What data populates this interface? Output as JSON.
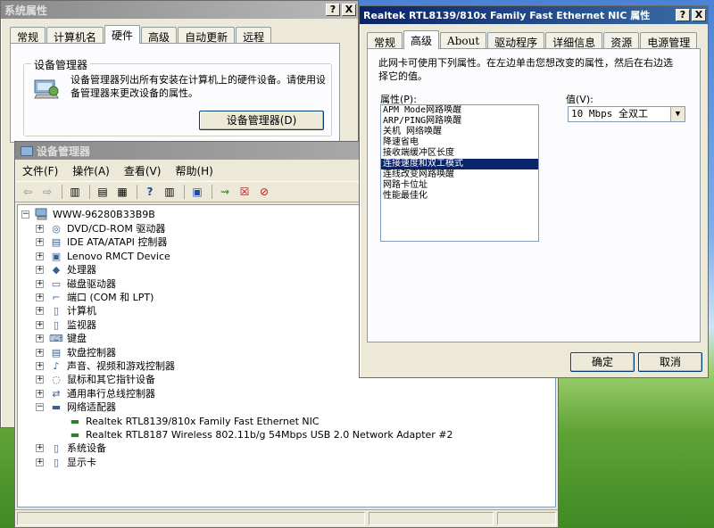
{
  "sysprops": {
    "title": "系统属性",
    "tabs": [
      "常规",
      "计算机名",
      "硬件",
      "高级",
      "自动更新",
      "远程"
    ],
    "selected_tab": "硬件",
    "devmgr_group_title": "设备管理器",
    "devmgr_desc": "设备管理器列出所有安装在计算机上的硬件设备。请使用设备管理器来更改设备的属性。",
    "devmgr_button": "设备管理器(D)",
    "help_btn": "?",
    "close_btn": "X"
  },
  "devmgr": {
    "title": "设备管理器",
    "menu": [
      "文件(F)",
      "操作(A)",
      "查看(V)",
      "帮助(H)"
    ],
    "root": "WWW-96280B33B9B",
    "items": [
      {
        "label": "DVD/CD-ROM 驱动器",
        "icon": "cdrom-icon",
        "glyph": "◎"
      },
      {
        "label": "IDE ATA/ATAPI 控制器",
        "icon": "ide-controller-icon",
        "glyph": "▤"
      },
      {
        "label": "Lenovo RMCT Device",
        "icon": "lenovo-device-icon",
        "glyph": "▣"
      },
      {
        "label": "处理器",
        "icon": "processor-icon",
        "glyph": "◆"
      },
      {
        "label": "磁盘驱动器",
        "icon": "disk-drive-icon",
        "glyph": "▭"
      },
      {
        "label": "端口 (COM 和 LPT)",
        "icon": "port-icon",
        "glyph": "⌐"
      },
      {
        "label": "计算机",
        "icon": "computer-icon",
        "glyph": "▯"
      },
      {
        "label": "监视器",
        "icon": "monitor-icon",
        "glyph": "▯"
      },
      {
        "label": "键盘",
        "icon": "keyboard-icon",
        "glyph": "⌨"
      },
      {
        "label": "软盘控制器",
        "icon": "floppy-controller-icon",
        "glyph": "▤"
      },
      {
        "label": "声音、视频和游戏控制器",
        "icon": "sound-icon",
        "glyph": "♪"
      },
      {
        "label": "鼠标和其它指针设备",
        "icon": "mouse-icon",
        "glyph": "◌"
      },
      {
        "label": "通用串行总线控制器",
        "icon": "usb-icon",
        "glyph": "⇄"
      },
      {
        "label": "网络适配器",
        "icon": "network-adapter-icon",
        "glyph": "▬"
      }
    ],
    "net_children": [
      "Realtek RTL8139/810x Family Fast Ethernet NIC",
      "Realtek RTL8187 Wireless 802.11b/g 54Mbps USB 2.0 Network Adapter #2"
    ],
    "items_after": [
      {
        "label": "系统设备",
        "icon": "system-device-icon",
        "glyph": "▯"
      },
      {
        "label": "显示卡",
        "icon": "display-card-icon",
        "glyph": "▯"
      }
    ]
  },
  "nicprops": {
    "title": "Realtek RTL8139/810x Family Fast Ethernet NIC 属性",
    "tabs": [
      "常规",
      "高级",
      "About",
      "驱动程序",
      "详细信息",
      "资源",
      "电源管理"
    ],
    "selected_tab": "高级",
    "desc": "此网卡可使用下列属性。在左边单击您想改变的属性，然后在右边选择它的值。",
    "property_label": "属性(P):",
    "value_label": "值(V):",
    "properties": [
      "APM Mode网路唤醒",
      "ARP/PING网路唤醒",
      "关机 网络唤醒",
      "降速省电",
      "接收端缓冲区长度",
      "连接速度和双工模式",
      "连线改变网路唤醒",
      "网路卡位址",
      "性能最佳化"
    ],
    "selected_property": "连接速度和双工模式",
    "value": "10 Mbps 全双工",
    "ok": "确定",
    "cancel": "取消",
    "help_btn": "?",
    "close_btn": "X"
  }
}
